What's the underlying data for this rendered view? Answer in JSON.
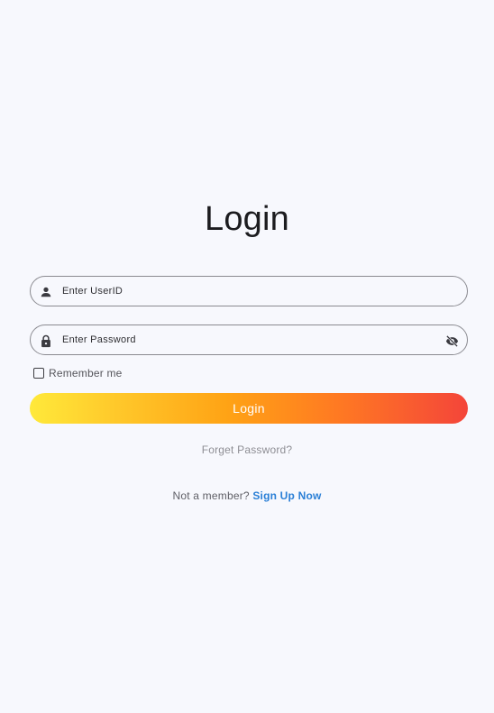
{
  "login": {
    "title": "Login",
    "userid_placeholder": "Enter UserID",
    "password_placeholder": "Enter Password",
    "remember_label": "Remember me",
    "remember_checked": false,
    "login_button_label": "Login",
    "forget_password_label": "Forget Password?",
    "not_member_text": "Not a member?",
    "signup_link_label": "Sign Up Now"
  },
  "icons": {
    "userid": "person-icon",
    "password": "lock-icon",
    "toggle_visibility": "eye-off-icon"
  },
  "colors": {
    "background": "#f7f8fd",
    "gradient_start": "#ffe93a",
    "gradient_end": "#f4453a",
    "link": "#2a7fd6"
  }
}
